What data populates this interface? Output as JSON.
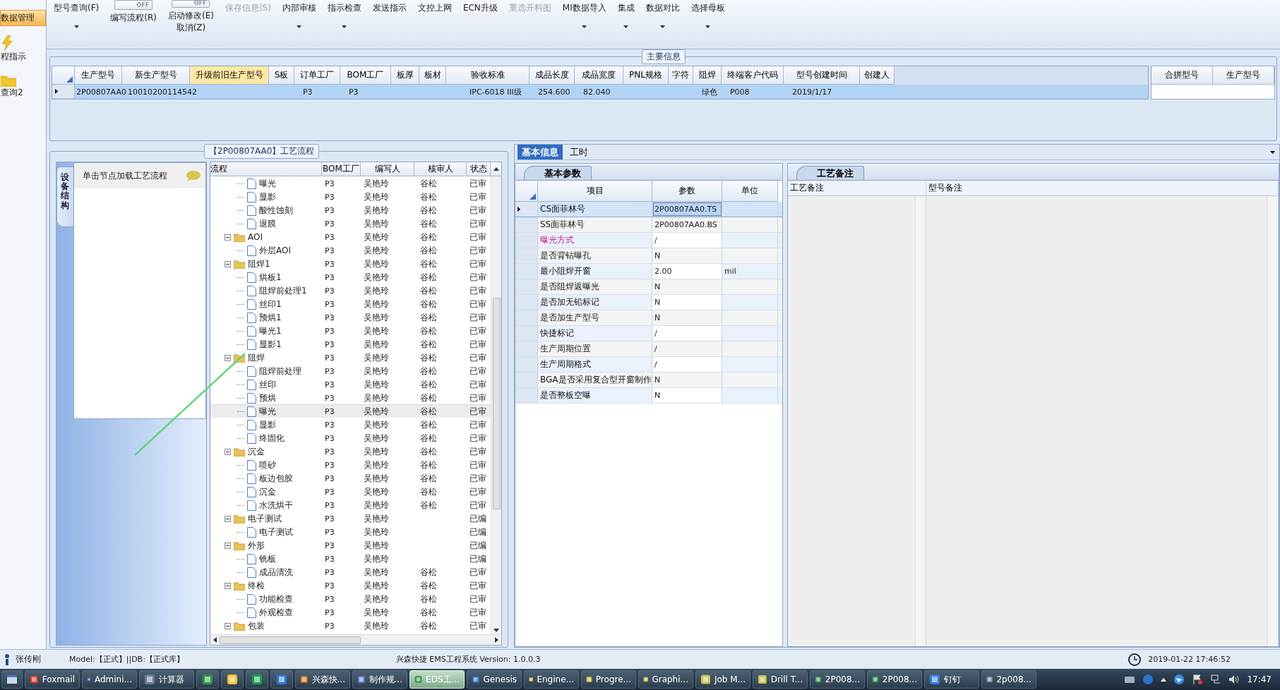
{
  "sidebar": {
    "items": [
      {
        "label": "数据管理",
        "kind": "text",
        "selected": true
      },
      {
        "label": "程指示",
        "kind": "lightning",
        "selected": false
      },
      {
        "label": "查询2",
        "kind": "folder",
        "selected": false
      }
    ]
  },
  "ribbon": {
    "items": [
      {
        "label": "型号查询(F)",
        "kind": "dropdown",
        "disabled": false
      },
      {
        "label": "编写流程(R)",
        "kind": "toggle",
        "toggle": "OFF",
        "on": false,
        "disabled": false
      },
      {
        "label": "启动修改(E)",
        "sublabel": "取消(Z)",
        "kind": "toggle",
        "toggle": "OFF",
        "on": false,
        "disabled": false
      },
      {
        "label": "保存信息(S)",
        "kind": "plain",
        "disabled": true
      },
      {
        "label": "内部审核",
        "kind": "dropdown",
        "disabled": false
      },
      {
        "label": "指示检查",
        "kind": "dropdown",
        "disabled": false
      },
      {
        "label": "发送指示",
        "kind": "plain",
        "disabled": false
      },
      {
        "label": "文控上网",
        "kind": "plain",
        "disabled": false
      },
      {
        "label": "ECN升级",
        "kind": "plain",
        "disabled": false
      },
      {
        "label": "重选开料图",
        "kind": "plain",
        "disabled": true
      },
      {
        "label": "MI数据导入",
        "kind": "dropdown",
        "disabled": false
      },
      {
        "label": "集成",
        "kind": "dropdown",
        "disabled": false
      },
      {
        "label": "数据对比",
        "kind": "dropdown",
        "disabled": false
      },
      {
        "label": "选择母板",
        "kind": "dropdown",
        "disabled": false
      }
    ]
  },
  "main_info": {
    "title": "主要信息",
    "columns": [
      {
        "label": "生产型号",
        "highlighted": false
      },
      {
        "label": "新生产型号",
        "highlighted": false
      },
      {
        "label": "升级前旧生产型号",
        "highlighted": true
      },
      {
        "label": "S板",
        "highlighted": false
      },
      {
        "label": "订单工厂",
        "highlighted": false
      },
      {
        "label": "BOM工厂",
        "highlighted": false
      },
      {
        "label": "板厚",
        "highlighted": false
      },
      {
        "label": "板材",
        "highlighted": false
      },
      {
        "label": "验收标准",
        "highlighted": false
      },
      {
        "label": "成品长度",
        "highlighted": false
      },
      {
        "label": "成品宽度",
        "highlighted": false
      },
      {
        "label": "PNL规格",
        "highlighted": false
      },
      {
        "label": "字符",
        "highlighted": false
      },
      {
        "label": "阻焊",
        "highlighted": false
      },
      {
        "label": "终端客户代码",
        "highlighted": false
      },
      {
        "label": "型号创建时间",
        "highlighted": false
      },
      {
        "label": "创建人",
        "highlighted": false
      }
    ],
    "rows": [
      {
        "selected": true,
        "cells": [
          "2P00807AA0",
          "10010200114542",
          null,
          null,
          "P3",
          "P3",
          null,
          null,
          "IPC-6018 III级",
          "254.600",
          "82.040",
          null,
          null,
          "绿色",
          "P008",
          "2019/1/17",
          null
        ]
      }
    ],
    "side_columns": [
      "合拼型号",
      "生产型号"
    ]
  },
  "flow": {
    "title": "【2P00807AA0】工艺流程",
    "side_tab": "设备结构",
    "hint": "单击节点加载工艺流程",
    "columns": [
      "流程",
      "BOM工厂",
      "编写人",
      "核审人",
      "状态"
    ],
    "rows": [
      {
        "children": [
          {
            "label": "曝光",
            "kind": "file",
            "bom": "P3",
            "writer": "吴艳玲",
            "reviewer": "谷松",
            "status": "已审",
            "selected": false
          },
          {
            "label": "显影",
            "kind": "file",
            "bom": "P3",
            "writer": "吴艳玲",
            "reviewer": "谷松",
            "status": "已审",
            "selected": false
          },
          {
            "label": "酸性蚀刻",
            "kind": "file",
            "bom": "P3",
            "writer": "吴艳玲",
            "reviewer": "谷松",
            "status": "已审",
            "selected": false
          },
          {
            "label": "退膜",
            "kind": "file",
            "bom": "P3",
            "writer": "吴艳玲",
            "reviewer": "谷松",
            "status": "已审",
            "selected": false
          }
        ]
      },
      {
        "label": "AOI",
        "kind": "folder",
        "expanded": true,
        "bom": "P3",
        "writer": "吴艳玲",
        "reviewer": "谷松",
        "status": "已审",
        "selected": false,
        "children": [
          {
            "label": "外层AOI",
            "kind": "file",
            "bom": "P3",
            "writer": "吴艳玲",
            "reviewer": "谷松",
            "status": "已审",
            "selected": false
          }
        ]
      },
      {
        "label": "阻焊1",
        "kind": "folder",
        "expanded": true,
        "bom": "P3",
        "writer": "吴艳玲",
        "reviewer": "谷松",
        "status": "已审",
        "selected": false,
        "children": [
          {
            "label": "烘板1",
            "kind": "file",
            "bom": "P3",
            "writer": "吴艳玲",
            "reviewer": "谷松",
            "status": "已审",
            "selected": false
          },
          {
            "label": "阻焊前处理1",
            "kind": "file",
            "bom": "P3",
            "writer": "吴艳玲",
            "reviewer": "谷松",
            "status": "已审",
            "selected": false
          },
          {
            "label": "丝印1",
            "kind": "file",
            "bom": "P3",
            "writer": "吴艳玲",
            "reviewer": "谷松",
            "status": "已审",
            "selected": false
          },
          {
            "label": "预烘1",
            "kind": "file",
            "bom": "P3",
            "writer": "吴艳玲",
            "reviewer": "谷松",
            "status": "已审",
            "selected": false
          },
          {
            "label": "曝光1",
            "kind": "file",
            "bom": "P3",
            "writer": "吴艳玲",
            "reviewer": "谷松",
            "status": "已审",
            "selected": false
          },
          {
            "label": "显影1",
            "kind": "file",
            "bom": "P3",
            "writer": "吴艳玲",
            "reviewer": "谷松",
            "status": "已审",
            "selected": false
          }
        ]
      },
      {
        "label": "阻焊",
        "kind": "folder",
        "expanded": true,
        "bom": "P3",
        "writer": "吴艳玲",
        "reviewer": "谷松",
        "status": "已审",
        "selected": false,
        "children": [
          {
            "label": "阻焊前处理",
            "kind": "file",
            "bom": "P3",
            "writer": "吴艳玲",
            "reviewer": "谷松",
            "status": "已审",
            "selected": false
          },
          {
            "label": "丝印",
            "kind": "file",
            "bom": "P3",
            "writer": "吴艳玲",
            "reviewer": "谷松",
            "status": "已审",
            "selected": false
          },
          {
            "label": "预烘",
            "kind": "file",
            "bom": "P3",
            "writer": "吴艳玲",
            "reviewer": "谷松",
            "status": "已审",
            "selected": false
          },
          {
            "label": "曝光",
            "kind": "file",
            "bom": "P3",
            "writer": "吴艳玲",
            "reviewer": "谷松",
            "status": "已审",
            "selected": true
          },
          {
            "label": "显影",
            "kind": "file",
            "bom": "P3",
            "writer": "吴艳玲",
            "reviewer": "谷松",
            "status": "已审",
            "selected": false
          },
          {
            "label": "终固化",
            "kind": "file",
            "bom": "P3",
            "writer": "吴艳玲",
            "reviewer": "谷松",
            "status": "已审",
            "selected": false
          }
        ]
      },
      {
        "label": "沉金",
        "kind": "folder",
        "expanded": true,
        "bom": "P3",
        "writer": "吴艳玲",
        "reviewer": "谷松",
        "status": "已审",
        "selected": false,
        "children": [
          {
            "label": "喷砂",
            "kind": "file",
            "bom": "P3",
            "writer": "吴艳玲",
            "reviewer": "谷松",
            "status": "已审",
            "selected": false
          },
          {
            "label": "板边包胶",
            "kind": "file",
            "bom": "P3",
            "writer": "吴艳玲",
            "reviewer": "谷松",
            "status": "已审",
            "selected": false
          },
          {
            "label": "沉金",
            "kind": "file",
            "bom": "P3",
            "writer": "吴艳玲",
            "reviewer": "谷松",
            "status": "已审",
            "selected": false
          },
          {
            "label": "水洗烘干",
            "kind": "file",
            "bom": "P3",
            "writer": "吴艳玲",
            "reviewer": "谷松",
            "status": "已审",
            "selected": false
          }
        ]
      },
      {
        "label": "电子测试",
        "kind": "folder",
        "expanded": true,
        "bom": "P3",
        "writer": "吴艳玲",
        "status": "已编",
        "selected": false,
        "children": [
          {
            "label": "电子测试",
            "kind": "file",
            "bom": "P3",
            "writer": "吴艳玲",
            "status": "已编",
            "selected": false
          }
        ]
      },
      {
        "label": "外形",
        "kind": "folder",
        "expanded": true,
        "bom": "P3",
        "writer": "吴艳玲",
        "status": "已编",
        "selected": false,
        "children": [
          {
            "label": "铣板",
            "kind": "file",
            "bom": "P3",
            "writer": "吴艳玲",
            "status": "已编",
            "selected": false
          },
          {
            "label": "成品清洗",
            "kind": "file",
            "bom": "P3",
            "writer": "吴艳玲",
            "reviewer": "谷松",
            "status": "已审",
            "selected": false
          }
        ]
      },
      {
        "label": "终检",
        "kind": "folder",
        "expanded": true,
        "bom": "P3",
        "writer": "吴艳玲",
        "reviewer": "谷松",
        "status": "已审",
        "selected": false,
        "children": [
          {
            "label": "功能检查",
            "kind": "file",
            "bom": "P3",
            "writer": "吴艳玲",
            "reviewer": "谷松",
            "status": "已审",
            "selected": false
          },
          {
            "label": "外观检查",
            "kind": "file",
            "bom": "P3",
            "writer": "吴艳玲",
            "reviewer": "谷松",
            "status": "已审",
            "selected": false
          }
        ]
      },
      {
        "label": "包装",
        "kind": "folder",
        "expanded": true,
        "bom": "P3",
        "writer": "吴艳玲",
        "reviewer": "谷松",
        "status": "已审",
        "selected": false
      }
    ]
  },
  "info_tabs": [
    {
      "label": "基本信息",
      "selected": true
    },
    {
      "label": "工时",
      "selected": false
    }
  ],
  "params": {
    "tab": "基本参数",
    "columns": [
      "项目",
      "参数",
      "单位"
    ],
    "rows": [
      {
        "item": "CS面菲林号",
        "value": "2P00807AA0.TS",
        "selected": true,
        "flagged": false
      },
      {
        "item": "SS面菲林号",
        "value": "2P00807AA0.BS",
        "selected": false,
        "flagged": false
      },
      {
        "item": "曝光方式",
        "value": "/",
        "selected": false,
        "flagged": true
      },
      {
        "item": "是否背钻曝孔",
        "value": "N",
        "selected": false,
        "flagged": false
      },
      {
        "item": "最小阻焊开窗",
        "value": "2.00",
        "unit": "mil",
        "selected": false,
        "flagged": false
      },
      {
        "item": "是否阻焊返曝光",
        "value": "N",
        "selected": false,
        "flagged": false
      },
      {
        "item": "是否加无铅标记",
        "value": "N",
        "selected": false,
        "flagged": false
      },
      {
        "item": "是否加生产型号",
        "value": "N",
        "selected": false,
        "flagged": false
      },
      {
        "item": "快捷标记",
        "value": "/",
        "selected": false,
        "flagged": false
      },
      {
        "item": "生产周期位置",
        "value": "/",
        "selected": false,
        "flagged": false
      },
      {
        "item": "生产周期格式",
        "value": "/",
        "selected": false,
        "flagged": false
      },
      {
        "item": "BGA是否采用复合型开窗制作",
        "value": "N",
        "selected": false,
        "flagged": false
      },
      {
        "item": "是否整板空曝",
        "value": "N",
        "selected": false,
        "flagged": false
      }
    ]
  },
  "notes": {
    "tab": "工艺备注",
    "columns": [
      "工艺备注",
      "型号备注"
    ]
  },
  "status_bar": {
    "user": "张传刚",
    "model": "Model:【正式】||DB:【正式库】",
    "app": "兴森快捷  EMS工程系统  Version: 1.0.0.3",
    "datetime": "2019-01-22 17:46:52"
  },
  "taskbar": {
    "items": [
      {
        "label": "Foxmail",
        "kind": "app",
        "selected": false
      },
      {
        "label": "Admini...",
        "kind": "app",
        "selected": false
      },
      {
        "label": "计算器",
        "kind": "app",
        "selected": false
      },
      {
        "kind": "icon",
        "selected": false
      },
      {
        "kind": "icon",
        "selected": false
      },
      {
        "kind": "icon",
        "selected": false
      },
      {
        "kind": "icon",
        "selected": false
      },
      {
        "label": "兴森快...",
        "kind": "app",
        "selected": false
      },
      {
        "label": "制作规...",
        "kind": "app",
        "selected": false
      },
      {
        "label": "EDS工...",
        "kind": "app",
        "selected": true
      },
      {
        "label": "Genesis",
        "kind": "app",
        "selected": false
      },
      {
        "label": "Engine...",
        "kind": "app",
        "selected": false
      },
      {
        "label": "Progre...",
        "kind": "app",
        "selected": false
      },
      {
        "label": "Graphi...",
        "kind": "app",
        "selected": false
      },
      {
        "label": "Job M...",
        "kind": "app",
        "selected": false
      },
      {
        "label": "Drill T...",
        "kind": "app",
        "selected": false
      },
      {
        "label": "2P008...",
        "kind": "app",
        "selected": false
      },
      {
        "label": "2P008...",
        "kind": "app",
        "selected": false
      },
      {
        "label": "钉钉",
        "kind": "app",
        "selected": false
      },
      {
        "label": "2p008...",
        "kind": "app",
        "selected": false
      }
    ],
    "clock": "17:47"
  }
}
